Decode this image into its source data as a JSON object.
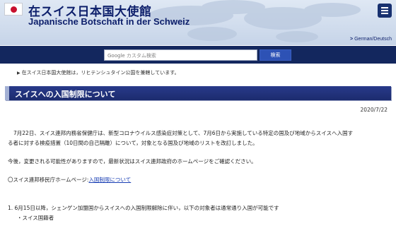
{
  "header": {
    "title_ja": "在スイス日本国大使館",
    "title_de": "Japanische Botschaft in der Schweiz",
    "language_link": "German/Deutsch",
    "colors": {
      "navy": "#13275e",
      "title": "#0d1f6b",
      "flag_red": "#c8102e"
    }
  },
  "search": {
    "google_label": "Google",
    "placeholder": "カスタム検索",
    "button_label": "検索"
  },
  "notice": "リヒテンシュタイン公国を兼轄しています。",
  "notice_prefix": "在スイス日本国大使館は，",
  "section": {
    "title": "スイスへの入国制限について",
    "date": "2020/7/22"
  },
  "content": {
    "p1a": "7月22日、スイス連邦内務省保健庁は、新型コロナウイルス感染症対策として、7月6日から実施している特定の国及び地域からスイスへ入国す",
    "p1b": "る者に対する検疫措置（10日間の自己隔離）について，対象となる国及び地域のリストを改訂しました。",
    "p2": "今後，変更される可能性がありますので，最新状況はスイス連邦政府のホームページをご確認ください。",
    "p3_prefix": "〇スイス連邦移民庁ホームページ:",
    "p3_link": "入国制限について",
    "p4": "1.  6月15日以降，シェンゲン加盟国からスイスへの入国制限解除に伴い，以下の対象者は通常通り入国が可能です",
    "p5": "・スイス国籍者"
  }
}
